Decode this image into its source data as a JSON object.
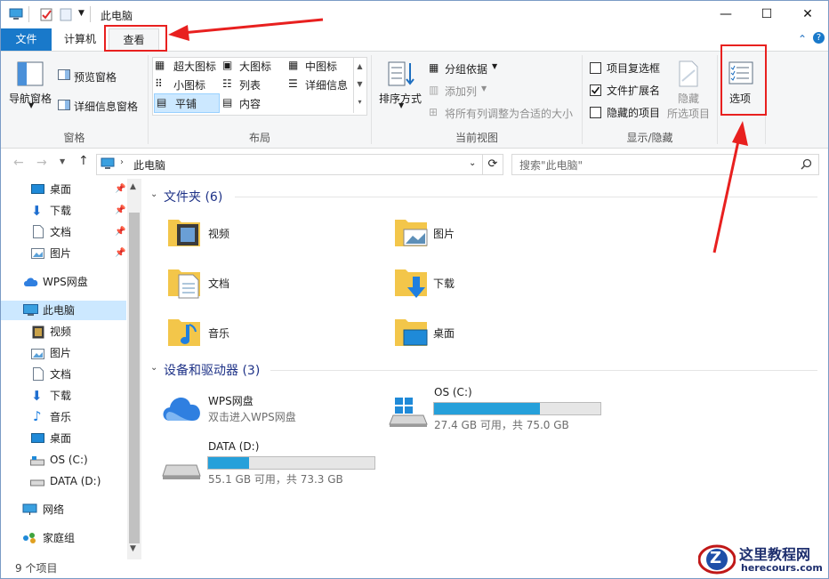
{
  "window": {
    "title": "此电脑",
    "caption": {
      "minimize": "—",
      "maximize": "☐",
      "close": "✕"
    }
  },
  "tabs": {
    "file": "文件",
    "computer": "计算机",
    "view": "查看"
  },
  "ribbon_controls": {
    "collapse": "⌃",
    "help": "?"
  },
  "ribbon": {
    "panes": {
      "label": "窗格",
      "nav_pane": "导航窗格",
      "preview": "预览窗格",
      "details": "详细信息窗格"
    },
    "layout": {
      "label": "布局",
      "items": [
        "超大图标",
        "大图标",
        "中图标",
        "小图标",
        "列表",
        "详细信息",
        "平铺",
        "内容"
      ],
      "selected": "平铺"
    },
    "current_view": {
      "label": "当前视图",
      "sort": "排序方式",
      "group": "分组依据",
      "add_col": "添加列",
      "fit_cols": "将所有列调整为合适的大小"
    },
    "show_hide": {
      "label": "显示/隐藏",
      "item_checkbox": "项目复选框",
      "item_checkbox_checked": false,
      "file_ext": "文件扩展名",
      "file_ext_checked": true,
      "hidden_items": "隐藏的项目",
      "hidden_items_checked": false,
      "hide": "隐藏",
      "hide_selected": "所选项目"
    },
    "options": "选项"
  },
  "address": {
    "path": "此电脑",
    "search_placeholder": "搜索\"此电脑\""
  },
  "nav": {
    "items": [
      "桌面",
      "下载",
      "文档",
      "图片",
      "WPS网盘",
      "此电脑",
      "视频",
      "图片",
      "文档",
      "下载",
      "音乐",
      "桌面",
      "OS (C:)",
      "DATA (D:)",
      "网络",
      "家庭组"
    ],
    "selected": "此电脑"
  },
  "content": {
    "folders_header": "文件夹 (6)",
    "folders": [
      "视频",
      "图片",
      "文档",
      "下载",
      "音乐",
      "桌面"
    ],
    "devices_header": "设备和驱动器 (3)",
    "wps": {
      "name": "WPS网盘",
      "desc": "双击进入WPS网盘"
    },
    "drive_c": {
      "name": "OS (C:)",
      "free": "27.4 GB 可用，共 75.0 GB",
      "used_fraction": 0.635
    },
    "drive_d": {
      "name": "DATA (D:)",
      "free": "55.1 GB 可用，共 73.3 GB",
      "used_fraction": 0.248
    }
  },
  "status": {
    "count": "9 个项目"
  },
  "watermark": {
    "name": "这里教程网",
    "url": "herecours.com",
    "logo_letter": "Z"
  },
  "colors": {
    "accent": "#1979ca",
    "annotation": "#e8201f",
    "drive_bar": "#26a0da"
  }
}
